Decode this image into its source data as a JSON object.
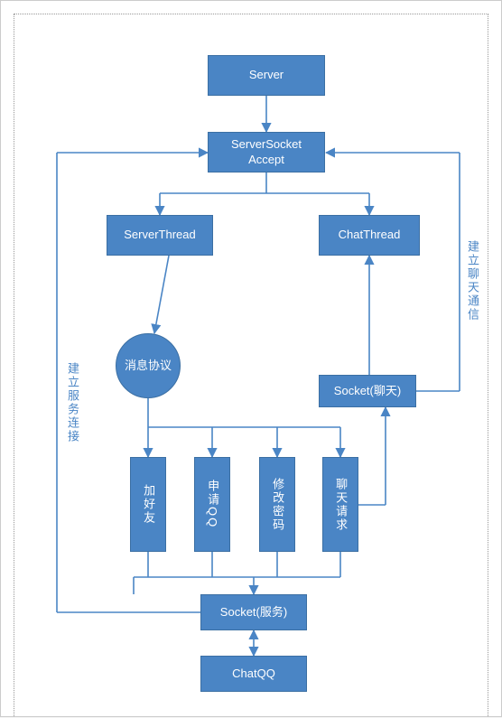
{
  "nodes": {
    "server": "Server",
    "accept": "ServerSocket\nAccept",
    "serverThread": "ServerThread",
    "chatThread": "ChatThread",
    "msgProto": "消息协议",
    "socketChat": "Socket(聊天)",
    "addFriend": "加好友",
    "applyQQ": "申请QQ",
    "changePwd": "修改密码",
    "chatReq": "聊天请求",
    "socketService": "Socket(服务)",
    "chatQQ": "ChatQQ"
  },
  "edges": {
    "leftLabel": "建立服务连接",
    "rightLabel": "建立聊天通信"
  },
  "colors": {
    "fill": "#4a85c5",
    "stroke": "#3b6fa3",
    "line": "#4a85c5"
  },
  "chart_data": {
    "type": "diagram",
    "title": "",
    "nodes": [
      {
        "id": "server",
        "label": "Server",
        "shape": "rect"
      },
      {
        "id": "accept",
        "label": "ServerSocket Accept",
        "shape": "rect"
      },
      {
        "id": "serverThread",
        "label": "ServerThread",
        "shape": "rect"
      },
      {
        "id": "chatThread",
        "label": "ChatThread",
        "shape": "rect"
      },
      {
        "id": "msgProto",
        "label": "消息协议",
        "shape": "circle"
      },
      {
        "id": "socketChat",
        "label": "Socket(聊天)",
        "shape": "rect"
      },
      {
        "id": "addFriend",
        "label": "加好友",
        "shape": "rect"
      },
      {
        "id": "applyQQ",
        "label": "申请QQ",
        "shape": "rect"
      },
      {
        "id": "changePwd",
        "label": "修改密码",
        "shape": "rect"
      },
      {
        "id": "chatReq",
        "label": "聊天请求",
        "shape": "rect"
      },
      {
        "id": "socketService",
        "label": "Socket(服务)",
        "shape": "rect"
      },
      {
        "id": "chatQQ",
        "label": "ChatQQ",
        "shape": "rect"
      }
    ],
    "edges": [
      {
        "from": "server",
        "to": "accept"
      },
      {
        "from": "accept",
        "to": "serverThread"
      },
      {
        "from": "accept",
        "to": "chatThread"
      },
      {
        "from": "serverThread",
        "to": "msgProto"
      },
      {
        "from": "msgProto",
        "to": "addFriend"
      },
      {
        "from": "msgProto",
        "to": "applyQQ"
      },
      {
        "from": "msgProto",
        "to": "changePwd"
      },
      {
        "from": "msgProto",
        "to": "chatReq"
      },
      {
        "from": "addFriend",
        "to": "socketService"
      },
      {
        "from": "applyQQ",
        "to": "socketService"
      },
      {
        "from": "changePwd",
        "to": "socketService"
      },
      {
        "from": "chatReq",
        "to": "socketService"
      },
      {
        "from": "socketService",
        "to": "chatQQ",
        "bidirectional": true
      },
      {
        "from": "socketService",
        "to": "accept",
        "label": "建立服务连接"
      },
      {
        "from": "socketChat",
        "to": "chatThread"
      },
      {
        "from": "socketChat",
        "to": "accept",
        "label": "建立聊天通信"
      },
      {
        "from": "chatReq",
        "to": "socketChat"
      }
    ]
  }
}
